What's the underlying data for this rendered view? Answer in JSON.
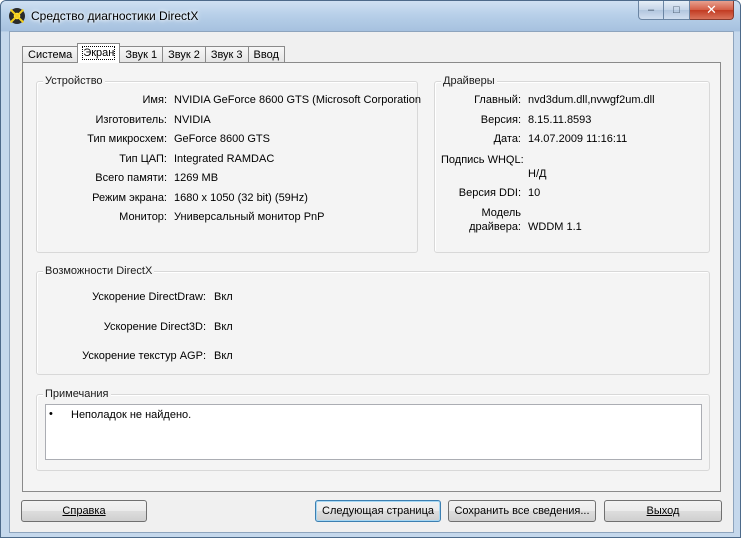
{
  "window": {
    "title": "Средство диагностики DirectX",
    "controls": {
      "minimize": "–",
      "maximize": "□",
      "close": "✕"
    }
  },
  "tabs": [
    {
      "label": "Система",
      "active": false
    },
    {
      "label": "Экран",
      "active": true
    },
    {
      "label": "Звук 1",
      "active": false
    },
    {
      "label": "Звук 2",
      "active": false
    },
    {
      "label": "Звук 3",
      "active": false
    },
    {
      "label": "Ввод",
      "active": false
    }
  ],
  "device": {
    "title": "Устройство",
    "fields": [
      {
        "label": "Имя:",
        "value": "NVIDIA GeForce 8600 GTS (Microsoft Corporation"
      },
      {
        "label": "Изготовитель:",
        "value": "NVIDIA"
      },
      {
        "label": "Тип микросхем:",
        "value": "GeForce 8600 GTS"
      },
      {
        "label": "Тип ЦАП:",
        "value": "Integrated RAMDAC"
      },
      {
        "label": "Всего памяти:",
        "value": "1269 MB"
      },
      {
        "label": "Режим экрана:",
        "value": "1680 x 1050 (32 bit) (59Hz)"
      },
      {
        "label": "Монитор:",
        "value": "Универсальный монитор PnP"
      }
    ]
  },
  "drivers": {
    "title": "Драйверы",
    "main_label": "Главный:",
    "main_value": "nvd3dum.dll,nvwgf2um.dll",
    "version_label": "Версия:",
    "version_value": "8.15.11.8593",
    "date_label": "Дата:",
    "date_value": "14.07.2009 11:16:11",
    "whql_label": "Подпись WHQL:",
    "whql_value": "Н/Д",
    "ddi_label": "Версия DDI:",
    "ddi_value": "10",
    "model_label_1": "Модель",
    "model_label_2": "драйвера:",
    "model_value": "WDDM 1.1"
  },
  "directx": {
    "title": "Возможности DirectX",
    "features": [
      {
        "label": "Ускорение DirectDraw:",
        "value": "Вкл"
      },
      {
        "label": "Ускорение Direct3D:",
        "value": "Вкл"
      },
      {
        "label": "Ускорение текстур AGP:",
        "value": "Вкл"
      }
    ]
  },
  "notes": {
    "title": "Примечания",
    "bullet": "•",
    "text": "Неполадок не найдено."
  },
  "buttons": {
    "help": "Справка",
    "next_page": "Следующая страница",
    "save_all": "Сохранить все сведения...",
    "exit": "Выход"
  }
}
